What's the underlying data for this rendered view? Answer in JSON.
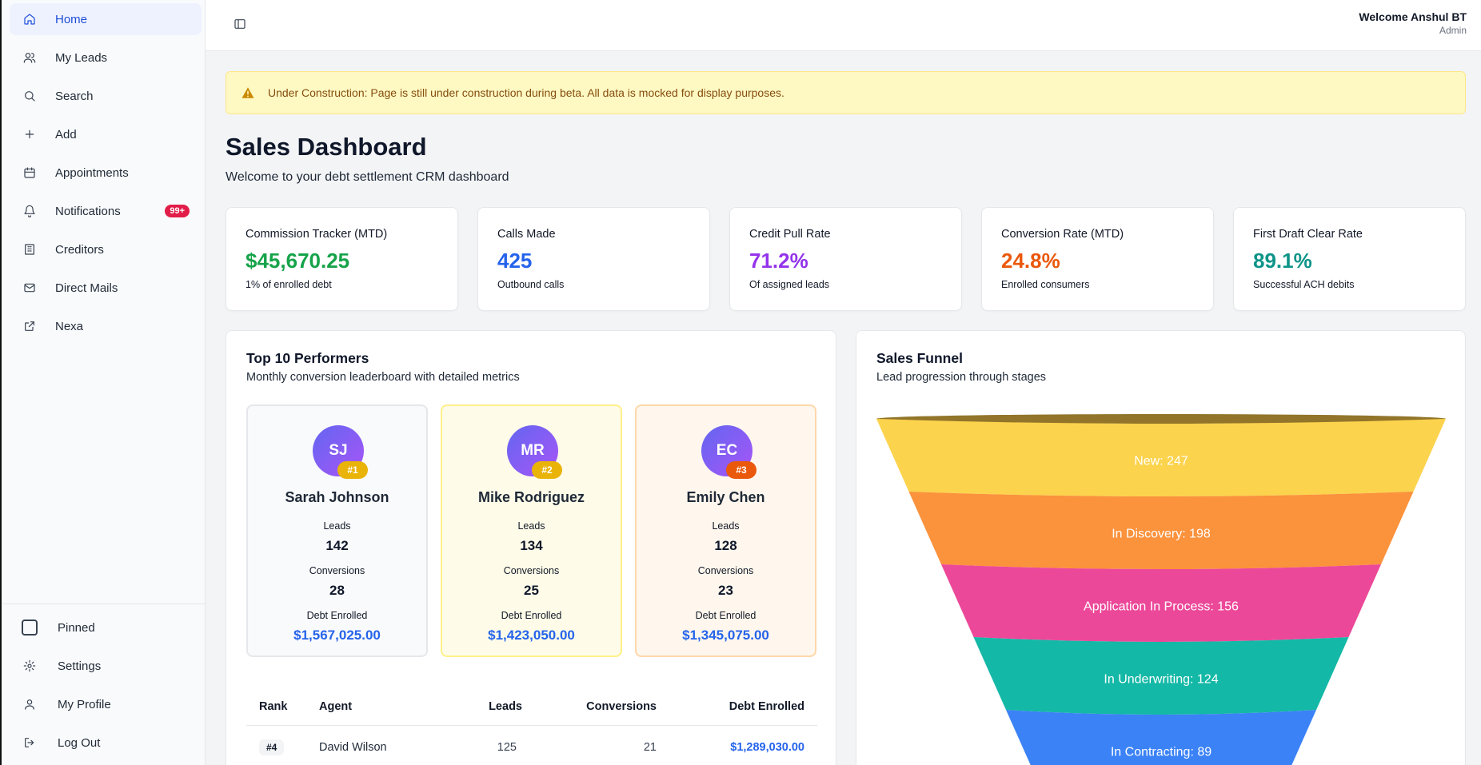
{
  "sidebar": {
    "items": [
      {
        "label": "Home",
        "icon": "home-icon"
      },
      {
        "label": "My Leads",
        "icon": "users-icon"
      },
      {
        "label": "Search",
        "icon": "search-icon"
      },
      {
        "label": "Add",
        "icon": "plus-icon"
      },
      {
        "label": "Appointments",
        "icon": "calendar-icon"
      },
      {
        "label": "Notifications",
        "icon": "bell-icon",
        "badge": "99+"
      },
      {
        "label": "Creditors",
        "icon": "building-icon"
      },
      {
        "label": "Direct Mails",
        "icon": "mail-icon"
      },
      {
        "label": "Nexa",
        "icon": "external-link-icon"
      }
    ],
    "bottom": [
      {
        "label": "Pinned",
        "icon": "pin-box-icon"
      },
      {
        "label": "Settings",
        "icon": "gear-icon"
      },
      {
        "label": "My Profile",
        "icon": "user-icon"
      },
      {
        "label": "Log Out",
        "icon": "logout-icon"
      }
    ]
  },
  "header": {
    "welcome": "Welcome Anshul BT",
    "role": "Admin"
  },
  "alert": {
    "text": "Under Construction: Page is still under construction during beta. All data is mocked for display purposes."
  },
  "page": {
    "title": "Sales Dashboard",
    "subtitle": "Welcome to your debt settlement CRM dashboard"
  },
  "stats": [
    {
      "title": "Commission Tracker (MTD)",
      "value": "$45,670.25",
      "sub": "1% of enrolled debt",
      "color": "#16a34a"
    },
    {
      "title": "Calls Made",
      "value": "425",
      "sub": "Outbound calls",
      "color": "#2563eb"
    },
    {
      "title": "Credit Pull Rate",
      "value": "71.2%",
      "sub": "Of assigned leads",
      "color": "#9333ea"
    },
    {
      "title": "Conversion Rate (MTD)",
      "value": "24.8%",
      "sub": "Enrolled consumers",
      "color": "#ea580c"
    },
    {
      "title": "First Draft Clear Rate",
      "value": "89.1%",
      "sub": "Successful ACH debits",
      "color": "#0d9488"
    }
  ],
  "performers": {
    "title": "Top 10 Performers",
    "subtitle": "Monthly conversion leaderboard with detailed metrics",
    "leads_label": "Leads",
    "conversions_label": "Conversions",
    "debt_label": "Debt Enrolled",
    "top": [
      {
        "initials": "SJ",
        "rank": "#1",
        "name": "Sarah Johnson",
        "leads": "142",
        "conversions": "28",
        "debt": "$1,567,025.00"
      },
      {
        "initials": "MR",
        "rank": "#2",
        "name": "Mike Rodriguez",
        "leads": "134",
        "conversions": "25",
        "debt": "$1,423,050.00"
      },
      {
        "initials": "EC",
        "rank": "#3",
        "name": "Emily Chen",
        "leads": "128",
        "conversions": "23",
        "debt": "$1,345,075.00"
      }
    ],
    "table": {
      "headers": [
        "Rank",
        "Agent",
        "Leads",
        "Conversions",
        "Debt Enrolled"
      ],
      "rows": [
        {
          "rank": "#4",
          "agent": "David Wilson",
          "leads": "125",
          "conversions": "21",
          "debt": "$1,289,030.00"
        }
      ]
    }
  },
  "funnel": {
    "title": "Sales Funnel",
    "subtitle": "Lead progression through stages",
    "stages": [
      {
        "label": "New: 247",
        "value": 247,
        "color": "#fcd34d"
      },
      {
        "label": "In Discovery: 198",
        "value": 198,
        "color": "#fb923c"
      },
      {
        "label": "Application In Process: 156",
        "value": 156,
        "color": "#ec4899"
      },
      {
        "label": "In Underwriting: 124",
        "value": 124,
        "color": "#14b8a6"
      },
      {
        "label": "In Contracting: 89",
        "value": 89,
        "color": "#3b82f6"
      }
    ]
  }
}
